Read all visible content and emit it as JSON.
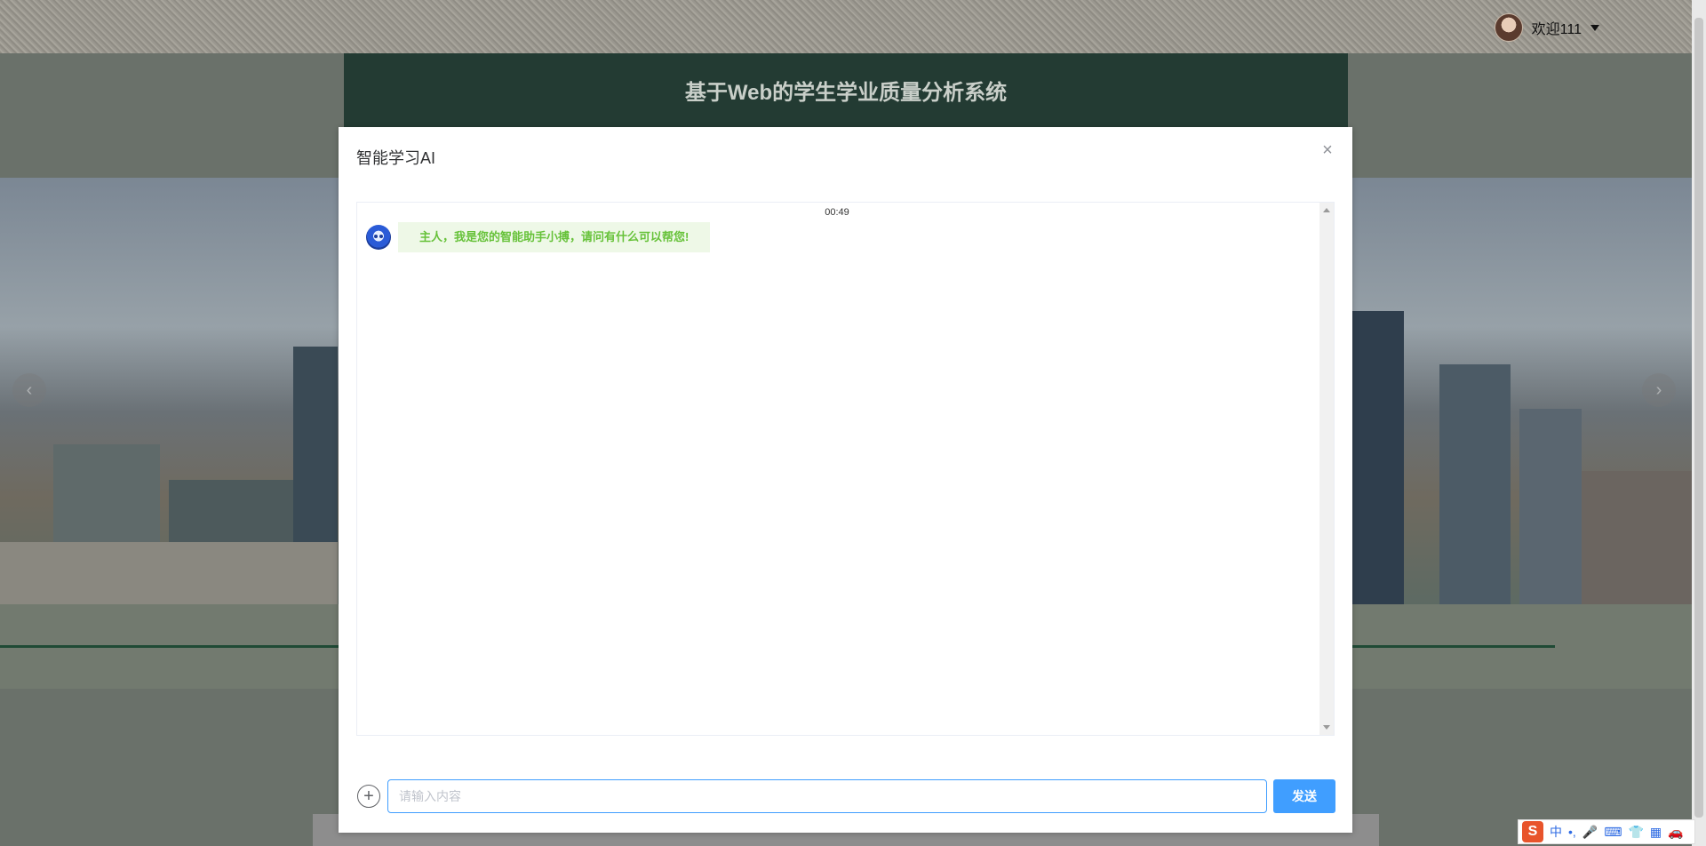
{
  "header": {
    "user_name": "欢迎111"
  },
  "site": {
    "title": "基于Web的学生学业质量分析系统"
  },
  "carousel": {
    "prev_symbol": "‹",
    "next_symbol": "›",
    "indicator_count": 4,
    "active_index": 0
  },
  "dialog": {
    "title": "智能学习AI",
    "close_symbol": "×",
    "chat": {
      "time": "00:49",
      "messages": [
        {
          "sender": "bot",
          "text": "主人，我是您的智能助手小搏，请问有什么可以帮您!"
        }
      ]
    },
    "input": {
      "placeholder": "请输入内容",
      "value": ""
    },
    "add_symbol": "+",
    "send_label": "发送"
  },
  "ime": {
    "logo": "S",
    "mode": "中",
    "punct": "•,",
    "mic": "🎤",
    "keyboard": "⌨",
    "shirt": "👕",
    "grid": "▦",
    "extra": "🚗"
  },
  "colors": {
    "primary": "#409eff",
    "bot_text": "#67c23a",
    "bot_bubble": "#eef8e7",
    "header_band": "#233b33"
  }
}
